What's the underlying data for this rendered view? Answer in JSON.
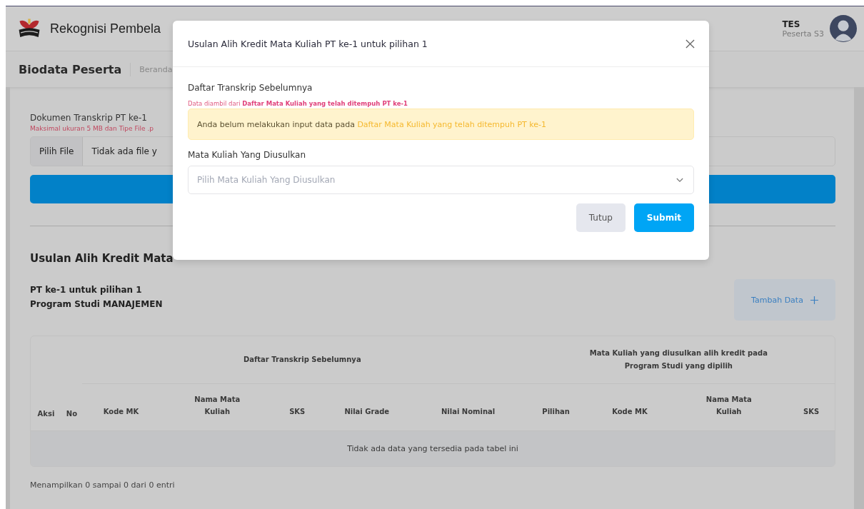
{
  "header": {
    "app_title": "Rekognisi Pembela",
    "user": {
      "name": "TES",
      "role": "Peserta S3"
    }
  },
  "subheader": {
    "title": "Biodata Peserta",
    "breadcrumb": "Beranda"
  },
  "upload": {
    "label": "Dokumen Transkrip PT ke-1",
    "hint": "Maksimal ukuran 5 MB dan Tipe File .p",
    "button": "Pilih File",
    "value": "Tidak ada file y"
  },
  "section": {
    "title": "Usulan Alih Kredit Mata",
    "program_lines": [
      "PT ke-1 untuk pilihan 1",
      "Program Studi MANAJEMEN"
    ],
    "add_button": "Tambah Data"
  },
  "table": {
    "leading_columns": [
      "Aksi",
      "No"
    ],
    "groups": [
      {
        "title": "Daftar Transkrip Sebelumnya",
        "columns": [
          "Kode MK",
          "Nama Mata Kuliah",
          "SKS",
          "Nilai Grade",
          "Nilai Nominal"
        ]
      },
      {
        "title": "Mata Kuliah yang diusulkan alih kredit pada Program Studi yang dipilih",
        "columns": [
          "Pilihan",
          "Kode MK",
          "Nama Mata Kuliah",
          "SKS"
        ]
      }
    ],
    "empty_message": "Tidak ada data yang tersedia pada tabel ini",
    "info": "Menampilkan 0 sampai 0 dari 0 entri"
  },
  "modal": {
    "title": "Usulan Alih Kredit Mata Kuliah PT ke-1 untuk pilihan 1",
    "section_label": "Daftar Transkrip Sebelumnya",
    "source_note": "Data diambil dari **Daftar Mata Kuliah yang telah ditempuh PT ke-1**",
    "alert": "Anda belum melakukan input data pada **Daftar Mata Kuliah yang telah ditempuh PT ke-1**",
    "select_label": "Mata Kuliah Yang Diusulkan",
    "select": {
      "placeholder": "Pilih Mata Kuliah Yang Diusulkan"
    },
    "buttons": [
      {
        "label": "Tutup",
        "kind": "secondary"
      },
      {
        "label": "Submit",
        "kind": "primary"
      }
    ]
  }
}
